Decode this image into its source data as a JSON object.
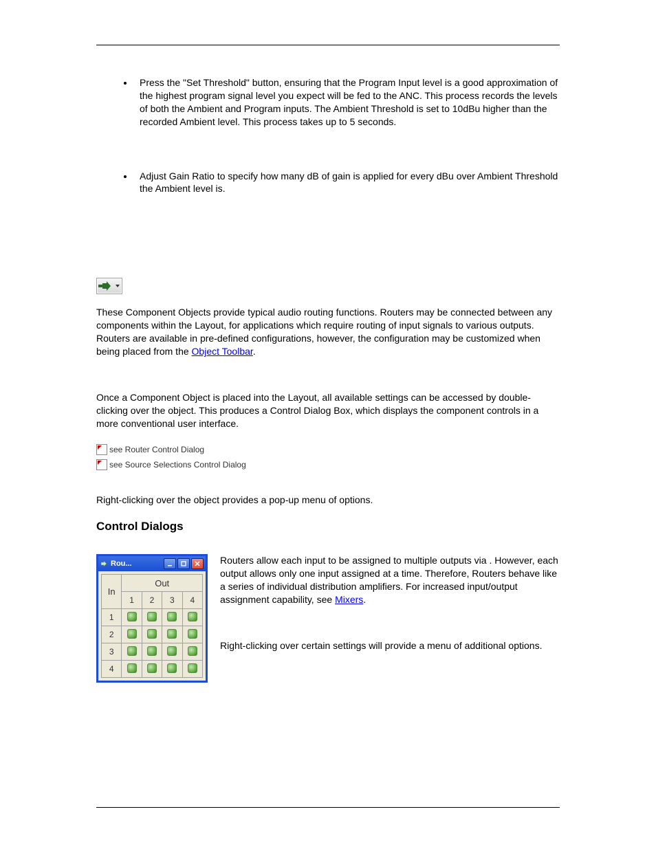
{
  "bullets": {
    "item1": "Press the \"Set Threshold\" button, ensuring that the Program Input level is a good approximation of the highest program signal level you expect will be fed to the ANC. This process records the levels of both the Ambient and Program inputs. The Ambient Threshold is set to 10dBu higher than the recorded Ambient level. This process takes up to 5 seconds.",
    "item2": "Adjust Gain Ratio to specify how many dB of gain is applied for every dBu over Ambient Threshold the Ambient level is."
  },
  "section1": {
    "para1_pre": "These Component Objects provide typical audio routing functions. Routers may be connected between any components within the Layout, for applications which require routing of input signals to various outputs. Routers are available in pre-defined configurations, however, the configuration may be customized when being placed from the ",
    "para1_link": "Object Toolbar",
    "para1_post": ".",
    "para2": "Once a Component Object is placed into the Layout, all available settings can be accessed by double-clicking over the object. This produces a Control Dialog Box, which displays the component controls in a more conventional user interface.",
    "see1": "see Router Control Dialog",
    "see2": "see Source Selections Control Dialog",
    "para3": "Right-clicking over the object provides a pop-up menu of options."
  },
  "heading": "Control Dialogs",
  "router": {
    "title": "Rou...",
    "in_label": "In",
    "out_label": "Out",
    "cols": [
      "1",
      "2",
      "3",
      "4"
    ],
    "rows": [
      "1",
      "2",
      "3",
      "4"
    ]
  },
  "section2": {
    "para1_pre": "Routers allow each input to be assigned to multiple outputs via                       . However, each output allows only one input assigned at a time. Therefore, Routers behave like a series of individual distribution amplifiers. For increased input/output assignment capability, see ",
    "para1_link": "Mixers",
    "para1_post": ".",
    "para2": "Right-clicking over certain settings will provide a menu of additional options."
  }
}
